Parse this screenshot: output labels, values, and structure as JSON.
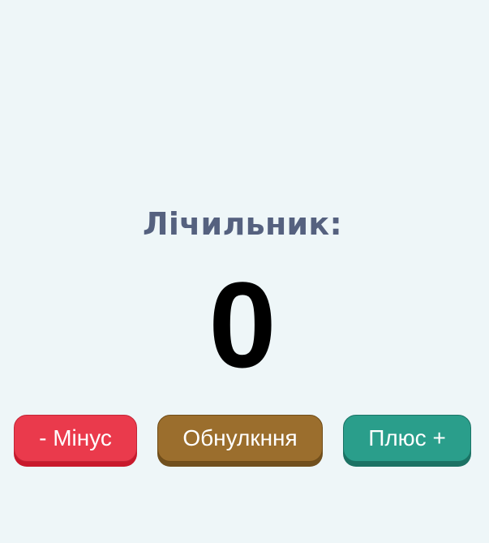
{
  "title": "Лічильник:",
  "counter": {
    "value": "0"
  },
  "buttons": {
    "minus_label": "- Мінус",
    "reset_label": "Обнулкння",
    "plus_label": "Плюс +"
  },
  "colors": {
    "background": "#eef6f8",
    "title": "#55617f",
    "minus": "#ea3a4c",
    "reset": "#9b6e2d",
    "plus": "#2a9e8b"
  }
}
